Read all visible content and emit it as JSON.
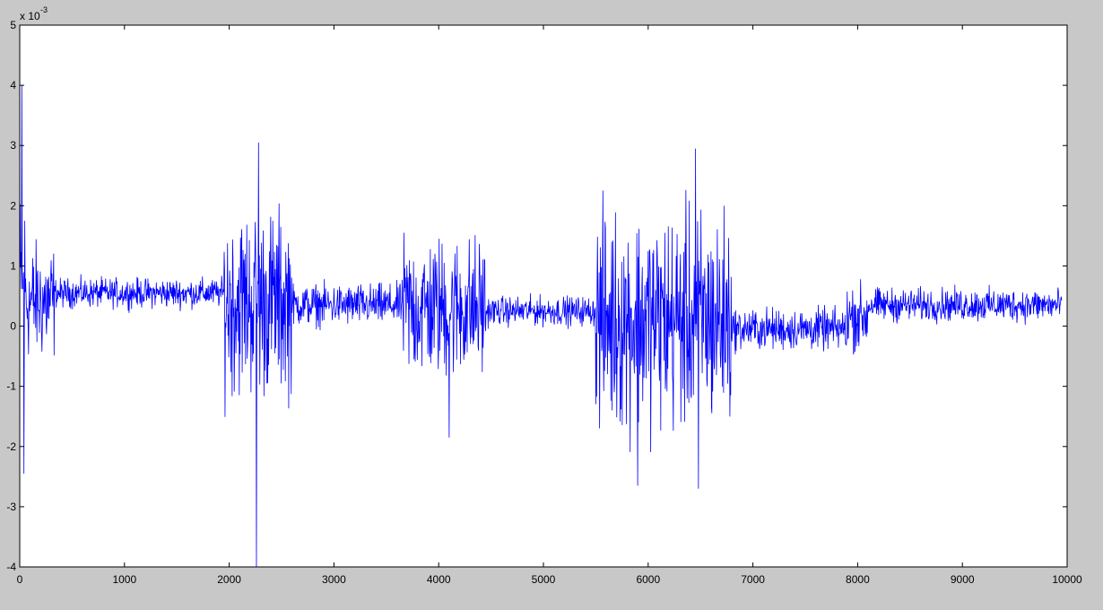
{
  "figure": {
    "background": "#c8c8c8",
    "axes_background": "#ffffff",
    "line_color": "#0000ff"
  },
  "chart_data": {
    "type": "line",
    "title": "",
    "xlabel": "",
    "ylabel": "",
    "exponent_base": "x 10",
    "exponent_power": "-3",
    "xlim": [
      0,
      10000
    ],
    "ylim": [
      -4,
      5
    ],
    "x_ticks": [
      0,
      1000,
      2000,
      3000,
      4000,
      5000,
      6000,
      7000,
      8000,
      9000,
      10000
    ],
    "x_tick_labels": [
      "0",
      "1000",
      "2000",
      "3000",
      "4000",
      "5000",
      "6000",
      "7000",
      "8000",
      "9000",
      "10000"
    ],
    "y_ticks": [
      -4,
      -3,
      -2,
      -1,
      0,
      1,
      2,
      3,
      4,
      5
    ],
    "y_tick_labels": [
      "-4",
      "-3",
      "-2",
      "-1",
      "0",
      "1",
      "2",
      "3",
      "4",
      "5"
    ],
    "grid": false,
    "n_samples": 10000,
    "segments": [
      {
        "x_start": 0,
        "x_end": 60,
        "center": 0.5,
        "amplitude": 2.7
      },
      {
        "x_start": 60,
        "x_end": 330,
        "center": 0.4,
        "amplitude": 1.4
      },
      {
        "x_start": 330,
        "x_end": 1950,
        "center": 0.55,
        "amplitude": 0.35
      },
      {
        "x_start": 1950,
        "x_end": 2600,
        "center": 0.4,
        "amplitude": 2.2
      },
      {
        "x_start": 2600,
        "x_end": 3650,
        "center": 0.35,
        "amplitude": 0.5
      },
      {
        "x_start": 3650,
        "x_end": 4450,
        "center": 0.3,
        "amplitude": 1.7
      },
      {
        "x_start": 4450,
        "x_end": 5500,
        "center": 0.25,
        "amplitude": 0.35
      },
      {
        "x_start": 5500,
        "x_end": 6800,
        "center": 0.1,
        "amplitude": 2.6
      },
      {
        "x_start": 6800,
        "x_end": 7900,
        "center": -0.05,
        "amplitude": 0.5
      },
      {
        "x_start": 7900,
        "x_end": 8100,
        "center": 0.15,
        "amplitude": 0.8
      },
      {
        "x_start": 8100,
        "x_end": 9950,
        "center": 0.35,
        "amplitude": 0.4
      }
    ],
    "extremes": [
      {
        "x": 20,
        "y": 4.0
      },
      {
        "x": 40,
        "y": -2.45
      },
      {
        "x": 2260,
        "y": -4.0
      },
      {
        "x": 2280,
        "y": 3.05
      },
      {
        "x": 4100,
        "y": -1.85
      },
      {
        "x": 5900,
        "y": -2.65
      },
      {
        "x": 6450,
        "y": 2.95
      },
      {
        "x": 6480,
        "y": -2.7
      }
    ]
  }
}
